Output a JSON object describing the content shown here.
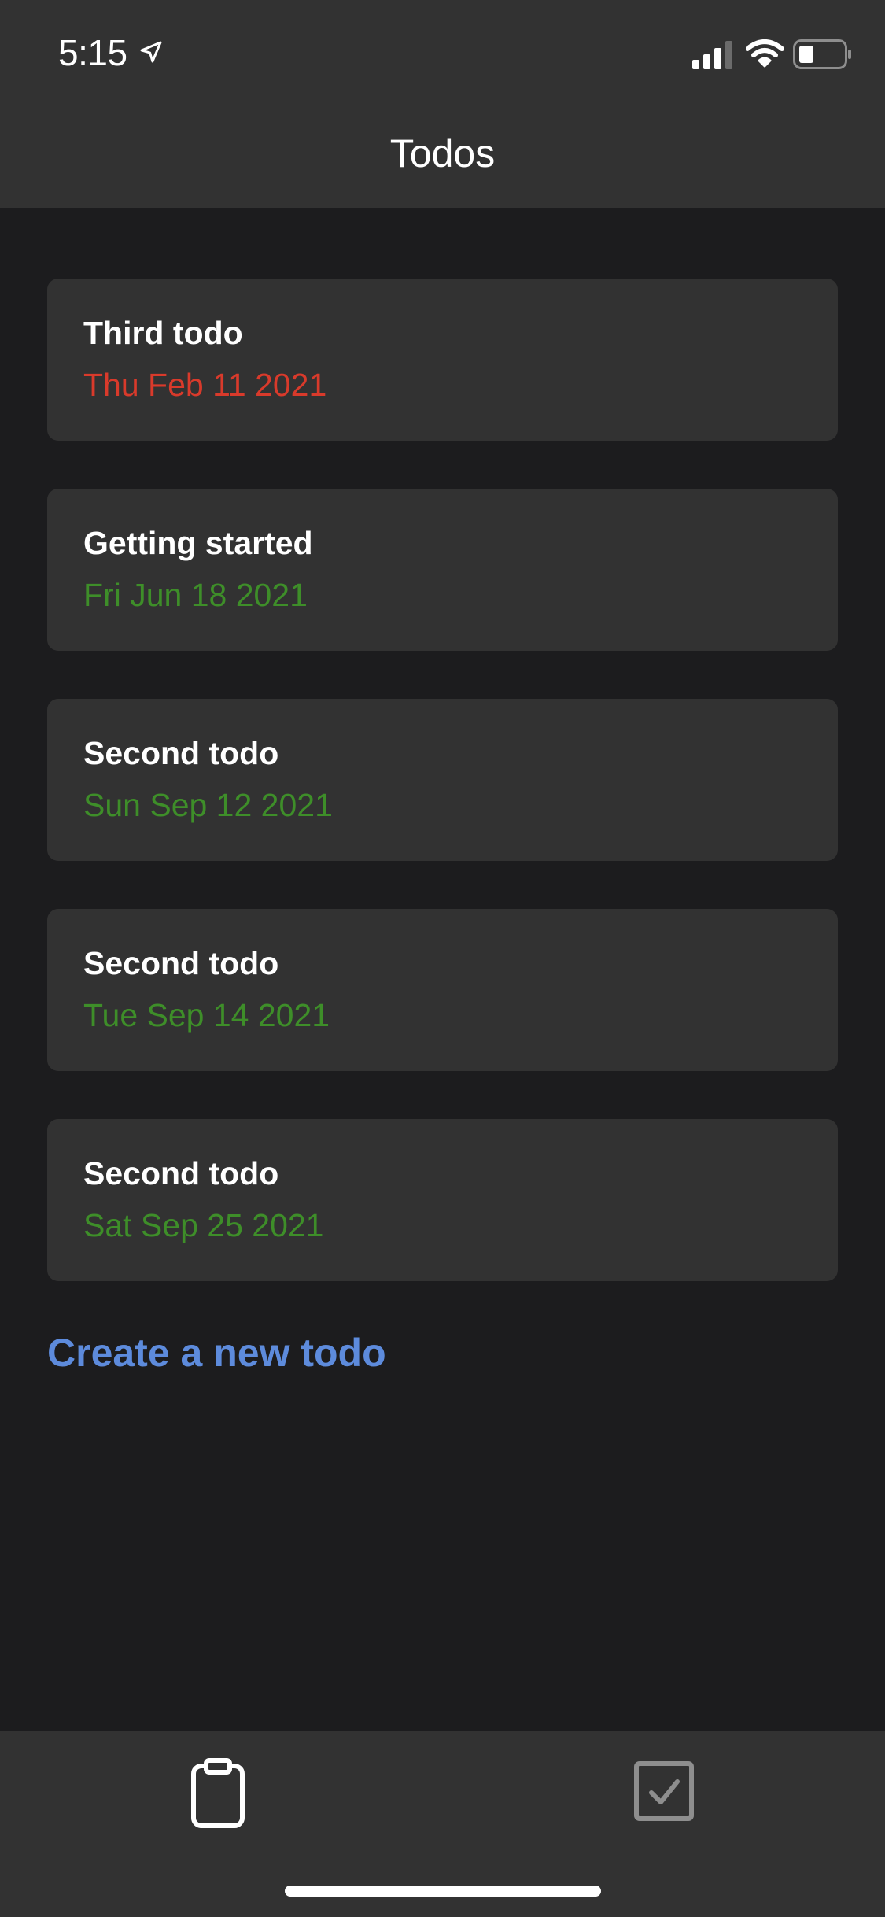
{
  "status_bar": {
    "time": "5:15",
    "location_icon": "location-arrow-icon",
    "signal_icon": "cellular-signal-icon",
    "wifi_icon": "wifi-icon",
    "battery_icon": "battery-icon"
  },
  "header": {
    "title": "Todos"
  },
  "todos": [
    {
      "title": "Third todo",
      "date": "Thu Feb 11 2021",
      "status": "overdue"
    },
    {
      "title": "Getting started",
      "date": "Fri Jun 18 2021",
      "status": "upcoming"
    },
    {
      "title": "Second todo",
      "date": "Sun Sep 12 2021",
      "status": "upcoming"
    },
    {
      "title": "Second todo",
      "date": "Tue Sep 14 2021",
      "status": "upcoming"
    },
    {
      "title": "Second todo",
      "date": "Sat Sep 25 2021",
      "status": "upcoming"
    }
  ],
  "create_link": "Create a new todo",
  "tab_bar": {
    "tabs": [
      {
        "icon": "clipboard-icon",
        "active": true
      },
      {
        "icon": "checkbox-checked-icon",
        "active": false
      }
    ]
  },
  "colors": {
    "overdue": "#d93a2b",
    "upcoming": "#3e8e29",
    "link": "#5d8bdc",
    "card": "#323232",
    "background": "#1c1c1e"
  }
}
